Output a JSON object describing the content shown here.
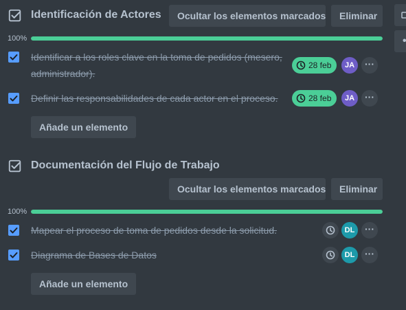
{
  "colors": {
    "background": "#323940",
    "progress": "#4bce97",
    "checkbox": "#579dff",
    "due_badge": "#4bce97",
    "avatar_ja": "#6e5dc6",
    "avatar_dl": "#1d9aaa"
  },
  "checklists": [
    {
      "title": "Identificación de Actores",
      "hide_checked_label": "Ocultar los elementos marcados",
      "delete_label": "Eliminar",
      "progress_label": "100%",
      "progress": 1.0,
      "items": [
        {
          "text": "Identificar a los roles clave en la toma de pedidos (mesero, administrador).",
          "checked": true,
          "due": "28 feb",
          "assignee": "JA"
        },
        {
          "text": "Definir las responsabilidades de cada actor en el proceso.",
          "checked": true,
          "due": "28 feb",
          "assignee": "JA"
        }
      ],
      "add_item_label": "Añade un elemento"
    },
    {
      "title": "Documentación del Flujo de Trabajo",
      "hide_checked_label": "Ocultar los elementos marcados",
      "delete_label": "Eliminar",
      "progress_label": "100%",
      "progress": 1.0,
      "items": [
        {
          "text": "Mapear el proceso de toma de pedidos desde la solicitud.",
          "checked": true,
          "due": "",
          "assignee": "DL"
        },
        {
          "text": "Diagrama de Bases de Datos",
          "checked": true,
          "due": "",
          "assignee": "DL"
        }
      ],
      "add_item_label": "Añade un elemento"
    }
  ]
}
